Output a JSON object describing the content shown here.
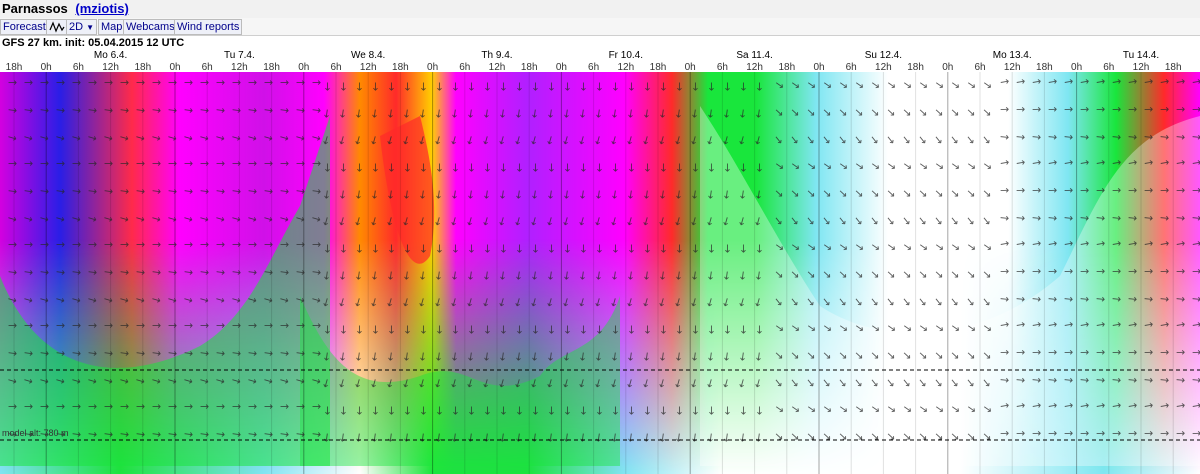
{
  "header": {
    "location": "Parnassos",
    "user": "(mziotis)"
  },
  "tabs": [
    {
      "label": "Forecast"
    },
    {
      "label": "2D"
    },
    {
      "label": "Map"
    },
    {
      "label": "Webcams"
    },
    {
      "label": "Wind reports"
    }
  ],
  "model_info": "GFS 27 km, init: 05.04.2015 12 UTC",
  "chart_data": {
    "type": "heatmap",
    "days": [
      "Mo 6.4.",
      "Tu 7.4.",
      "We 8.4.",
      "Th 9.4.",
      "Fr 10.4.",
      "Sa 11.4.",
      "Su 12.4.",
      "Mo 13.4.",
      "Tu 14.4."
    ],
    "hour_labels": [
      "18h",
      "0h",
      "6h",
      "12h",
      "18h",
      "0h",
      "6h",
      "12h",
      "18h",
      "0h",
      "6h",
      "12h",
      "18h",
      "0h",
      "6h",
      "12h",
      "18h",
      "0h",
      "6h",
      "12h",
      "18h",
      "0h",
      "6h",
      "12h",
      "18h",
      "0h",
      "6h",
      "12h",
      "18h",
      "0h",
      "6h",
      "12h",
      "18h",
      "0h",
      "6h",
      "12h",
      "18h",
      "0h"
    ],
    "model_alt_label": "model alt: 780 m",
    "colors": {
      "calm": "#ffffff",
      "light": "#7fe6f2",
      "moderate": "#19e63c",
      "strong": "#ff9a00",
      "very_strong": "#ff2a2a",
      "stormy": "#ff00ff",
      "extreme": "#2a1ee6"
    }
  }
}
